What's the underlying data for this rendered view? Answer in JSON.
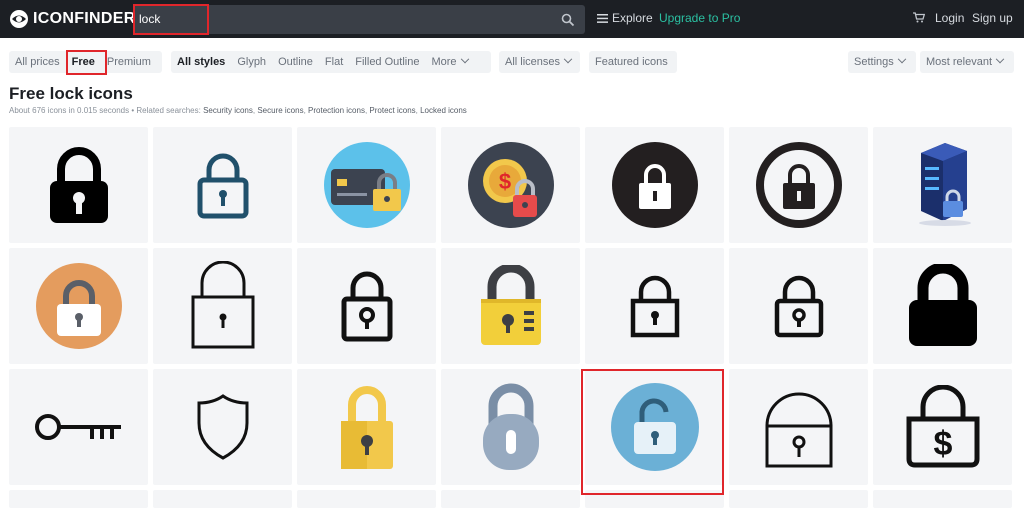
{
  "header": {
    "logo_text": "ICONFINDER",
    "search_value": "lock",
    "nav": {
      "explore": "Explore",
      "upgrade": "Upgrade to Pro",
      "login": "Login",
      "signup": "Sign up"
    }
  },
  "filters": {
    "price": [
      "All prices",
      "Free",
      "Premium"
    ],
    "price_active": "Free",
    "styles": [
      "All styles",
      "Glyph",
      "Outline",
      "Flat",
      "Filled Outline"
    ],
    "styles_more": "More",
    "license": "All licenses",
    "featured": "Featured icons",
    "settings": "Settings",
    "sort": "Most relevant"
  },
  "results": {
    "title": "Free lock icons",
    "summary": "About 676 icons in 0.015 seconds",
    "related_prefix": "Related searches:",
    "related": [
      "Security icons",
      "Secure icons",
      "Protection icons",
      "Protect icons",
      "Locked icons"
    ]
  },
  "icons": [
    {
      "name": "lock-black-glyph-icon"
    },
    {
      "name": "lock-blue-outline-icon"
    },
    {
      "name": "credit-card-lock-icon"
    },
    {
      "name": "dollar-coin-lock-icon"
    },
    {
      "name": "lock-black-circle-icon"
    },
    {
      "name": "lock-circle-outline-icon"
    },
    {
      "name": "server-lock-icon"
    },
    {
      "name": "lock-orange-circle-icon"
    },
    {
      "name": "lock-thin-outline-icon"
    },
    {
      "name": "lock-bold-outline-icon"
    },
    {
      "name": "lock-yellow-combination-icon"
    },
    {
      "name": "lock-small-outline-icon"
    },
    {
      "name": "lock-small-outline-icon-2"
    },
    {
      "name": "lock-black-filled-icon"
    },
    {
      "name": "key-icon"
    },
    {
      "name": "shield-icon"
    },
    {
      "name": "lock-yellow-flat-icon"
    },
    {
      "name": "lock-grey-pill-icon"
    },
    {
      "name": "unlock-blue-circle-icon"
    },
    {
      "name": "lock-arched-outline-icon"
    },
    {
      "name": "lock-dollar-icon"
    }
  ],
  "colors": {
    "topbar": "#1c1f24",
    "accent_upgrade": "#2bc0a2",
    "highlight": "#e0262b",
    "tile": "#f4f5f7"
  }
}
